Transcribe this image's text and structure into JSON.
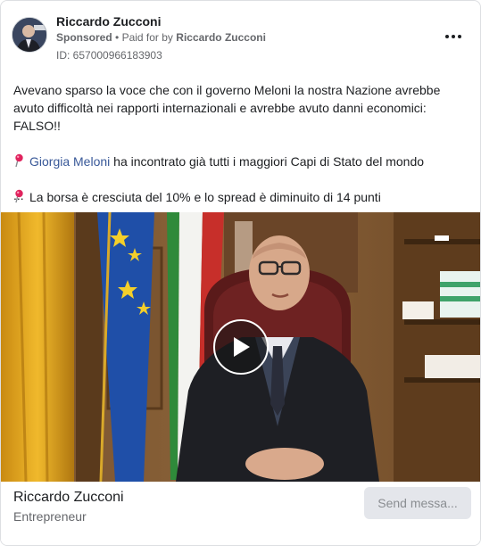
{
  "post": {
    "author_name": "Riccardo Zucconi",
    "sponsored_label": "Sponsored",
    "separator": "•",
    "paid_for_prefix": "Paid for by",
    "paid_for_name": "Riccardo Zucconi",
    "ad_id": "ID: 657000966183903",
    "more_icon": "more-horizontal-icon"
  },
  "body": {
    "paragraph_1": "Avevano sparso la voce che con il governo Meloni la nostra Nazione avrebbe avuto difficoltà nei rapporti internazionali e avrebbe avuto danni economici: FALSO!!",
    "paragraph_2_mention": "Giorgia Meloni",
    "paragraph_2_rest": " ha incontrato già tutti i maggiori Capi di Stato del mondo",
    "paragraph_3": "La borsa è cresciuta del 10% e lo spread è diminuito di 14 punti",
    "ellipsis": "...",
    "pin_icon": "round-pushpin-icon",
    "pin_color": "#e0245e"
  },
  "video": {
    "play_icon": "play-icon"
  },
  "footer": {
    "name": "Riccardo Zucconi",
    "subtitle": "Entrepreneur",
    "cta_label": "Send messa..."
  },
  "colors": {
    "link": "#385898",
    "secondary_text": "#65676b",
    "cta_bg": "#e4e6eb",
    "cta_text": "#8a8d91"
  }
}
